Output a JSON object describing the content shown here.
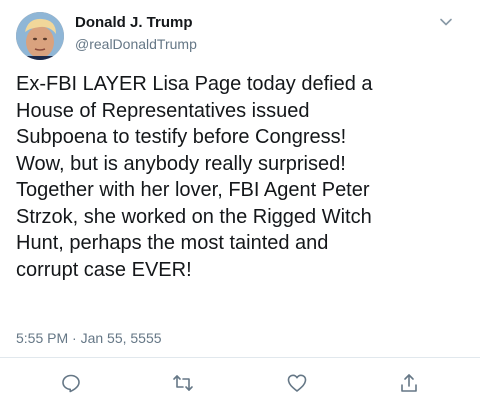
{
  "user": {
    "display_name": "Donald J. Trump",
    "handle": "@realDonaldTrump",
    "avatar_icon": "avatar-photo"
  },
  "tweet": {
    "text": "Ex-FBI LAYER Lisa Page today defied a\nHouse of Representatives issued\nSubpoena to testify before Congress!\nWow, but is anybody really surprised!\nTogether with her lover, FBI Agent Peter\nStrzok, she worked on the Rigged Witch\nHunt, perhaps the most tainted and\ncorrupt case EVER!",
    "timestamp": "5:55 PM · Jan 55, 5555"
  },
  "actions": {
    "reply_icon": "reply-icon",
    "retweet_icon": "retweet-icon",
    "like_icon": "heart-icon",
    "share_icon": "share-icon"
  },
  "colors": {
    "text": "#14171a",
    "secondary": "#657786",
    "divider": "#e1e8ed",
    "icon": "#657786"
  }
}
